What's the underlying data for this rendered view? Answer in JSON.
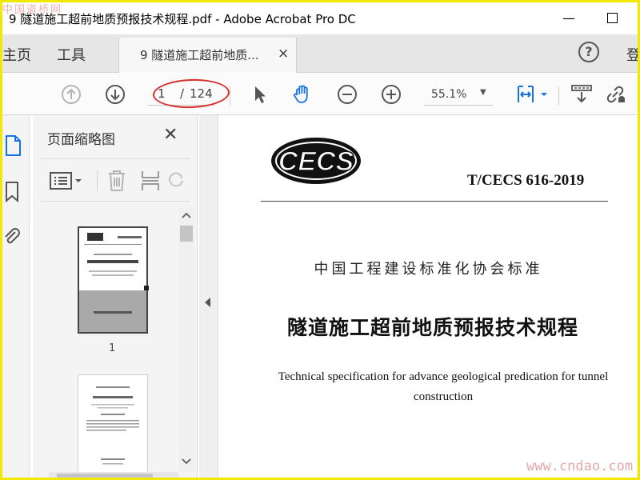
{
  "window": {
    "title": "9 隧道施工超前地质预报技术规程.pdf - Adobe Acrobat Pro DC",
    "minimize_glyph": "—"
  },
  "watermarks": {
    "top": "中国道桥网",
    "bottom": "www.cndao.com"
  },
  "tabs": {
    "home": "主页",
    "tools": "工具",
    "document": "9 隧道施工超前地质...",
    "close_glyph": "×",
    "help_glyph": "?",
    "login": "登"
  },
  "toolbar": {
    "current_page": "1",
    "page_separator": "/",
    "total_pages": "124",
    "zoom": "55.1%",
    "zoom_caret": "▼",
    "icons": [
      "page-up-icon",
      "page-down-icon",
      "select-cursor-icon",
      "hand-tool-icon",
      "zoom-out-icon",
      "zoom-in-icon",
      "fit-width-icon",
      "scroll-mode-icon",
      "share-link-icon"
    ]
  },
  "thumbnails_panel": {
    "title": "页面缩略图",
    "close_glyph": "✕",
    "thumbnails": [
      {
        "label": "1"
      }
    ]
  },
  "document": {
    "logo_text": "CECS",
    "standard_code": "T/CECS 616-2019",
    "association": "中国工程建设标准化协会标准",
    "title": "隧道施工超前地质预报技术规程",
    "english_title": "Technical specification for advance geological predication for tunnel construction"
  },
  "colors": {
    "frame": "#f0e800",
    "accent_blue": "#1473e6",
    "annotation_red": "#d8302c"
  }
}
